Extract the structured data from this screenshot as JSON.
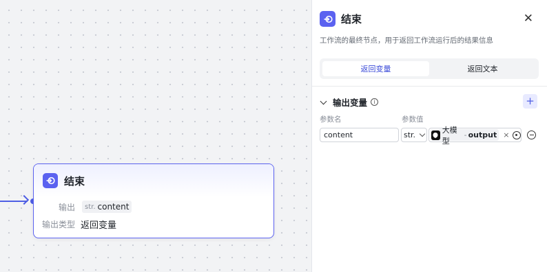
{
  "node": {
    "title": "结束",
    "output_label": "输出",
    "output_type": "str.",
    "output_name": "content",
    "output_type_label": "输出类型",
    "output_type_value": "返回变量"
  },
  "panel": {
    "title": "结束",
    "description": "工作流的最终节点，用于返回工作流运行后的结果信息",
    "tabs": [
      {
        "label": "返回变量",
        "active": true
      },
      {
        "label": "返回文本",
        "active": false
      }
    ],
    "section_title": "输出变量",
    "columns": {
      "name": "参数名",
      "value": "参数值"
    },
    "params": [
      {
        "name": "content",
        "type": "str.",
        "ref_node": "大模型",
        "ref_sep": "-",
        "ref_var": "output"
      }
    ]
  },
  "icons": {
    "close": "close-icon",
    "end": "end-node-icon",
    "add": "plus-icon",
    "remove": "minus-circle-icon",
    "info": "info-icon",
    "llm": "llm-model-icon"
  },
  "colors": {
    "accent": "#5b62f0",
    "edge": "#4e5ee4"
  }
}
